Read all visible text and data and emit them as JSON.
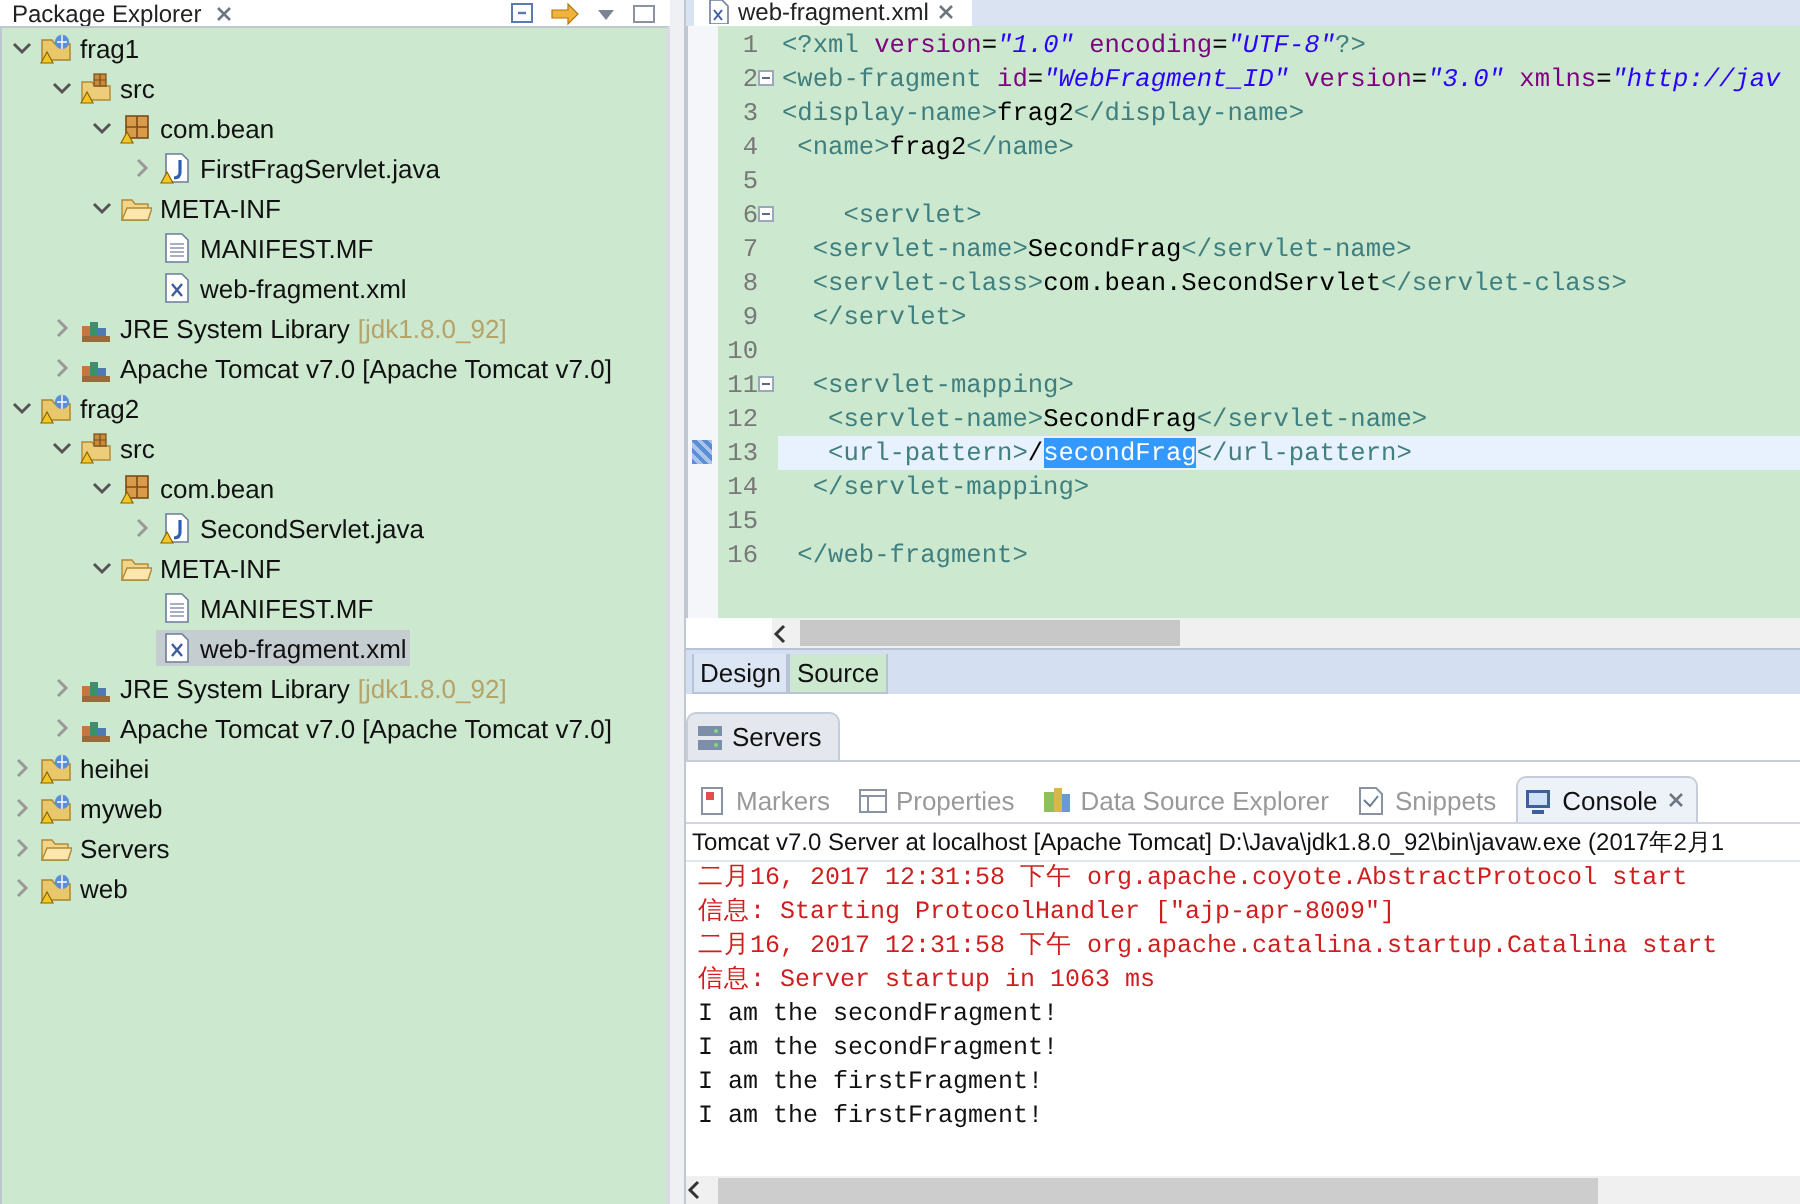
{
  "package_explorer": {
    "title": "Package Explorer",
    "tree": [
      {
        "label": "frag1",
        "kind": "project",
        "expanded": true,
        "selected": false,
        "children": [
          {
            "label": "src",
            "kind": "src",
            "expanded": true,
            "selected": false,
            "children": [
              {
                "label": "com.bean",
                "kind": "package",
                "expanded": true,
                "selected": false,
                "children": [
                  {
                    "label": "FirstFragServlet.java",
                    "kind": "java",
                    "expanded": false,
                    "selected": false
                  }
                ]
              },
              {
                "label": "META-INF",
                "kind": "folder",
                "expanded": true,
                "selected": false,
                "children": [
                  {
                    "label": "MANIFEST.MF",
                    "kind": "file",
                    "selected": false
                  },
                  {
                    "label": "web-fragment.xml",
                    "kind": "xml",
                    "selected": false
                  }
                ]
              }
            ]
          },
          {
            "label": "JRE System Library",
            "decoration": "[jdk1.8.0_92]",
            "kind": "library",
            "expanded": false,
            "selected": false
          },
          {
            "label": "Apache Tomcat v7.0 [Apache Tomcat v7.0]",
            "kind": "library",
            "expanded": false,
            "selected": false
          }
        ]
      },
      {
        "label": "frag2",
        "kind": "project",
        "expanded": true,
        "selected": false,
        "children": [
          {
            "label": "src",
            "kind": "src",
            "expanded": true,
            "selected": false,
            "children": [
              {
                "label": "com.bean",
                "kind": "package",
                "expanded": true,
                "selected": false,
                "children": [
                  {
                    "label": "SecondServlet.java",
                    "kind": "java",
                    "expanded": false,
                    "selected": false
                  }
                ]
              },
              {
                "label": "META-INF",
                "kind": "folder",
                "expanded": true,
                "selected": false,
                "children": [
                  {
                    "label": "MANIFEST.MF",
                    "kind": "file",
                    "selected": false
                  },
                  {
                    "label": "web-fragment.xml",
                    "kind": "xml",
                    "selected": true
                  }
                ]
              }
            ]
          },
          {
            "label": "JRE System Library",
            "decoration": "[jdk1.8.0_92]",
            "kind": "library",
            "expanded": false,
            "selected": false
          },
          {
            "label": "Apache Tomcat v7.0 [Apache Tomcat v7.0]",
            "kind": "library",
            "expanded": false,
            "selected": false
          }
        ]
      },
      {
        "label": "heihei",
        "kind": "project",
        "expanded": false,
        "selected": false
      },
      {
        "label": "myweb",
        "kind": "project",
        "expanded": false,
        "selected": false
      },
      {
        "label": "Servers",
        "kind": "folder",
        "expanded": false,
        "selected": false
      },
      {
        "label": "web",
        "kind": "project",
        "expanded": false,
        "selected": false
      }
    ]
  },
  "editor": {
    "tab": {
      "title": "web-fragment.xml"
    },
    "lines": [
      {
        "number": "1",
        "fold": false,
        "current": false,
        "annotated": false,
        "tokens": [
          {
            "kind": "tag",
            "text": "<?xml"
          },
          {
            "kind": "attr",
            "text": " version"
          },
          {
            "kind": "text",
            "text": "="
          },
          {
            "kind": "value",
            "text": "\"1.0\""
          },
          {
            "kind": "attr",
            "text": " encoding"
          },
          {
            "kind": "text",
            "text": "="
          },
          {
            "kind": "value",
            "text": "\"UTF-8\""
          },
          {
            "kind": "tag",
            "text": "?>"
          }
        ]
      },
      {
        "number": "2",
        "fold": true,
        "current": false,
        "annotated": false,
        "tokens": [
          {
            "kind": "tag",
            "text": "<web-fragment"
          },
          {
            "kind": "attr",
            "text": " id"
          },
          {
            "kind": "text",
            "text": "="
          },
          {
            "kind": "value",
            "text": "\"WebFragment_ID\""
          },
          {
            "kind": "attr",
            "text": " version"
          },
          {
            "kind": "text",
            "text": "="
          },
          {
            "kind": "value",
            "text": "\"3.0\""
          },
          {
            "kind": "attr",
            "text": " xmlns"
          },
          {
            "kind": "text",
            "text": "="
          },
          {
            "kind": "value",
            "text": "\"http://jav"
          }
        ]
      },
      {
        "number": "3",
        "fold": false,
        "current": false,
        "annotated": false,
        "tokens": [
          {
            "kind": "tag",
            "text": "<display-name>"
          },
          {
            "kind": "text",
            "text": "frag2"
          },
          {
            "kind": "tag",
            "text": "</display-name>"
          }
        ]
      },
      {
        "number": "4",
        "fold": false,
        "current": false,
        "annotated": false,
        "tokens": [
          {
            "kind": "tag",
            "text": " <name>"
          },
          {
            "kind": "text",
            "text": "frag2"
          },
          {
            "kind": "tag",
            "text": "</name>"
          }
        ]
      },
      {
        "number": "5",
        "fold": false,
        "current": false,
        "annotated": false
      },
      {
        "number": "6",
        "fold": true,
        "current": false,
        "annotated": false,
        "tokens": [
          {
            "kind": "tag",
            "text": "    <servlet>"
          }
        ]
      },
      {
        "number": "7",
        "fold": false,
        "current": false,
        "annotated": false,
        "tokens": [
          {
            "kind": "tag",
            "text": "  <servlet-name>"
          },
          {
            "kind": "text",
            "text": "SecondFrag"
          },
          {
            "kind": "tag",
            "text": "</servlet-name>"
          }
        ]
      },
      {
        "number": "8",
        "fold": false,
        "current": false,
        "annotated": false,
        "tokens": [
          {
            "kind": "tag",
            "text": "  <servlet-class>"
          },
          {
            "kind": "text",
            "text": "com.bean.SecondServlet"
          },
          {
            "kind": "tag",
            "text": "</servlet-class>"
          }
        ]
      },
      {
        "number": "9",
        "fold": false,
        "current": false,
        "annotated": false,
        "tokens": [
          {
            "kind": "tag",
            "text": "  </servlet>"
          }
        ]
      },
      {
        "number": "10",
        "fold": false,
        "current": false,
        "annotated": false
      },
      {
        "number": "11",
        "fold": true,
        "current": false,
        "annotated": false,
        "tokens": [
          {
            "kind": "tag",
            "text": "  <servlet-mapping>"
          }
        ]
      },
      {
        "number": "12",
        "fold": false,
        "current": false,
        "annotated": false,
        "tokens": [
          {
            "kind": "tag",
            "text": "   <servlet-name>"
          },
          {
            "kind": "text",
            "text": "SecondFrag"
          },
          {
            "kind": "tag",
            "text": "</servlet-name>"
          }
        ]
      },
      {
        "number": "13",
        "fold": false,
        "current": true,
        "annotated": true,
        "tokens": [
          {
            "kind": "tag",
            "text": "   <url-pattern>"
          },
          {
            "kind": "text",
            "text": "/"
          },
          {
            "kind": "selection",
            "text": "secondFrag"
          },
          {
            "kind": "tag",
            "text": "</url-pattern>"
          }
        ]
      },
      {
        "number": "14",
        "fold": false,
        "current": false,
        "annotated": false,
        "tokens": [
          {
            "kind": "tag",
            "text": "  </servlet-mapping>"
          }
        ]
      },
      {
        "number": "15",
        "fold": false,
        "current": false,
        "annotated": false
      },
      {
        "number": "16",
        "fold": false,
        "current": false,
        "annotated": false,
        "tokens": [
          {
            "kind": "tag",
            "text": " </web-fragment>"
          }
        ]
      }
    ],
    "bottom_tabs": [
      {
        "label": "Design",
        "selected": false
      },
      {
        "label": "Source",
        "selected": true
      }
    ]
  },
  "servers_view": {
    "title": "Servers"
  },
  "console_view": {
    "tabs": [
      {
        "label": "Markers",
        "selected": false
      },
      {
        "label": "Properties",
        "selected": false
      },
      {
        "label": "Data Source Explorer",
        "selected": false
      },
      {
        "label": "Snippets",
        "selected": false
      },
      {
        "label": "Console",
        "selected": true
      }
    ],
    "process_title": "Tomcat v7.0 Server at localhost [Apache Tomcat] D:\\Java\\jdk1.8.0_92\\bin\\javaw.exe (2017年2月1",
    "lines": [
      {
        "kind": "log",
        "text": "二月16, 2017 12:31:58 下午 org.apache.coyote.AbstractProtocol start"
      },
      {
        "kind": "log",
        "text": "信息: Starting ProtocolHandler [\"ajp-apr-8009\"]"
      },
      {
        "kind": "log",
        "text": "二月16, 2017 12:31:58 下午 org.apache.catalina.startup.Catalina start"
      },
      {
        "kind": "log",
        "text": "信息: Server startup in 1063 ms"
      },
      {
        "kind": "output",
        "text": "I am the secondFragment!"
      },
      {
        "kind": "output",
        "text": "I am the secondFragment!"
      },
      {
        "kind": "output",
        "text": "I am the firstFragment!"
      },
      {
        "kind": "output",
        "text": "I am the firstFragment!"
      }
    ]
  }
}
